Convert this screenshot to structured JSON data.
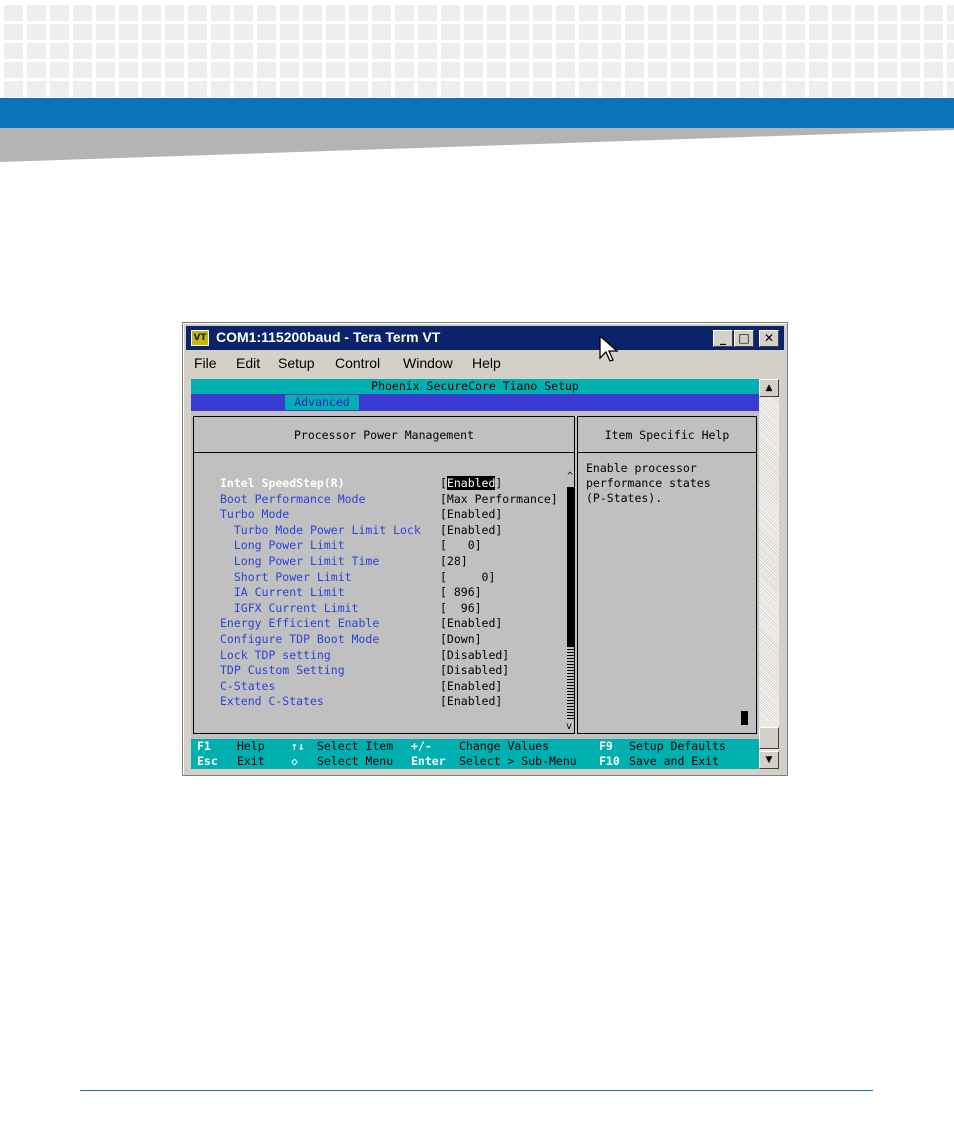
{
  "window": {
    "title": "COM1:115200baud - Tera Term VT",
    "icon_label": "VT",
    "controls": {
      "minimize": "_",
      "maximize": "□",
      "close": "✕"
    }
  },
  "menubar": [
    "File",
    "Edit",
    "Setup",
    "Control",
    "Window",
    "Help"
  ],
  "bios": {
    "title": "Phoenix SecureCore Tiano Setup",
    "active_tab": "Advanced",
    "panel_title": "Processor Power Management",
    "help_title": "Item Specific Help",
    "help_text": "Enable processor\nperformance states\n(P-States).",
    "settings": [
      {
        "label": "Intel SpeedStep(R)",
        "value": "Enabled",
        "selected": true
      },
      {
        "label": "Boot Performance Mode",
        "value": "[Max Performance]"
      },
      {
        "label": "Turbo Mode",
        "value": "[Enabled]"
      },
      {
        "label": "  Turbo Mode Power Limit Lock",
        "value": "[Enabled]"
      },
      {
        "label": "  Long Power Limit",
        "value": "[   0]"
      },
      {
        "label": "  Long Power Limit Time",
        "value": "[28]"
      },
      {
        "label": "  Short Power Limit",
        "value": "[     0]"
      },
      {
        "label": "  IA Current Limit",
        "value": "[ 896]"
      },
      {
        "label": "  IGFX Current Limit",
        "value": "[  96]"
      },
      {
        "label": "Energy Efficient Enable",
        "value": "[Enabled]"
      },
      {
        "label": "Configure TDP Boot Mode",
        "value": "[Down]"
      },
      {
        "label": "Lock TDP setting",
        "value": "[Disabled]"
      },
      {
        "label": "TDP Custom Setting",
        "value": "[Disabled]"
      },
      {
        "label": "C-States",
        "value": "[Enabled]"
      },
      {
        "label": "Extend C-States",
        "value": "[Enabled]"
      }
    ],
    "keys": [
      {
        "key": "F1",
        "desc": "Help"
      },
      {
        "key": "↑↓",
        "desc": "Select Item"
      },
      {
        "key": "+/-",
        "desc": "Change Values"
      },
      {
        "key": "F9",
        "desc": "Setup Defaults"
      },
      {
        "key": "Esc",
        "desc": "Exit"
      },
      {
        "key": "◇",
        "desc": "Select Menu"
      },
      {
        "key": "Enter",
        "desc": "Select > Sub-Menu"
      },
      {
        "key": "F10",
        "desc": "Save and Exit"
      }
    ]
  },
  "colors": {
    "brand_blue": "#0a73b9",
    "title_bar": "#0a246a",
    "bios_cyan": "#00b0b0",
    "bios_blue": "#3a3ad0"
  }
}
